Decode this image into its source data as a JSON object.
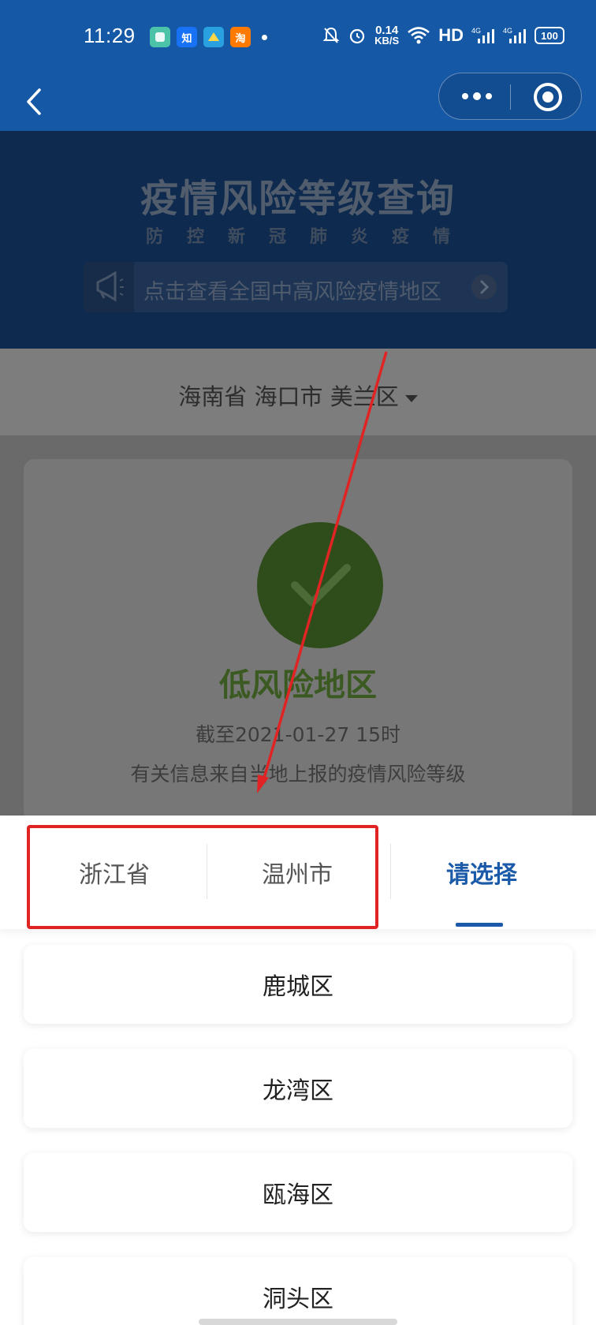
{
  "status_bar": {
    "time": "11:29",
    "apps": [
      {
        "icon": "messages-app-icon",
        "label": "",
        "color": "#4cc2a8"
      },
      {
        "icon": "zhihu-app-icon",
        "label": "知",
        "color": "#1772f6"
      },
      {
        "icon": "maps-app-icon",
        "label": "",
        "color": "#2aa0e0"
      },
      {
        "icon": "taobao-app-icon",
        "label": "淘",
        "color": "#ff7a00"
      }
    ],
    "net_speed_value": "0.14",
    "net_speed_unit": "KB/S",
    "hd_label": "HD",
    "battery": "100",
    "icons": [
      "mute-icon",
      "alarm-icon",
      "wifi-icon",
      "signal-4g-icon",
      "signal-4g-icon",
      "battery-icon"
    ]
  },
  "background_page": {
    "banner_title": "疫情风险等级查询",
    "banner_subtitle": "防控新冠肺炎疫情",
    "notice_text": "点击查看全国中高风险疫情地区",
    "region_selector": "海南省 海口市 美兰区",
    "risk_level": "低风险地区",
    "risk_time": "截至2021-01-27 15时",
    "risk_info": "有关信息来自当地上报的疫情风险等级",
    "colors": {
      "overlay_banner": "#0e2a4f",
      "risk_green": "#2f4c1b"
    }
  },
  "picker": {
    "tabs": [
      {
        "label": "浙江省"
      },
      {
        "label": "温州市"
      },
      {
        "label": "请选择"
      }
    ],
    "active_tab_index": 2,
    "options": [
      {
        "label": "鹿城区"
      },
      {
        "label": "龙湾区"
      },
      {
        "label": "瓯海区"
      },
      {
        "label": "洞头区"
      }
    ],
    "accent_color": "#1a5aa8",
    "annotation_color": "#e02424"
  }
}
